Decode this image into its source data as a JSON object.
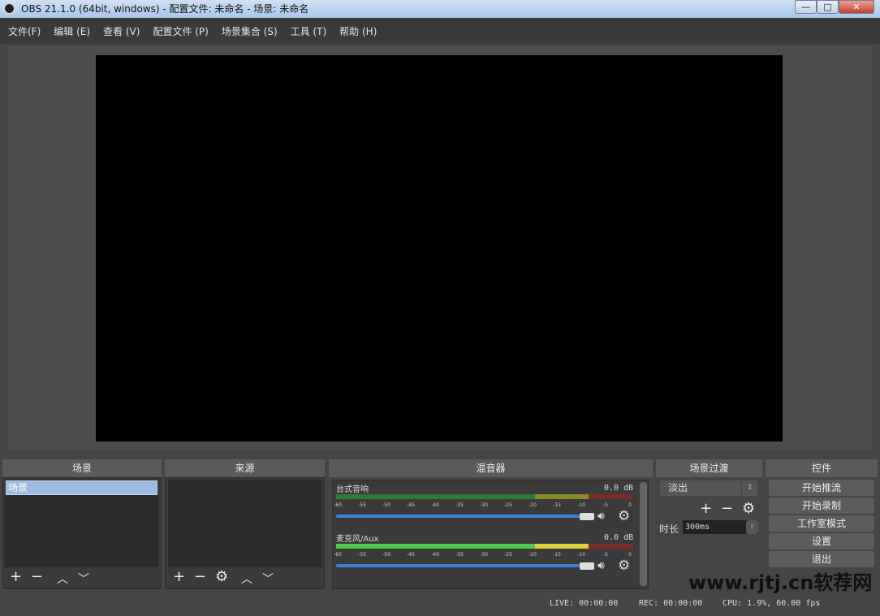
{
  "window": {
    "title": "OBS 21.1.0 (64bit, windows) - 配置文件: 未命名 - 场景: 未命名",
    "minimize": "—",
    "maximize": "□",
    "close": "✕"
  },
  "menu": [
    "文件(F)",
    "编辑 (E)",
    "查看 (V)",
    "配置文件 (P)",
    "场景集合 (S)",
    "工具 (T)",
    "帮助 (H)"
  ],
  "docks": {
    "scenes": "场景",
    "sources": "来源",
    "mixer": "混音器",
    "transitions": "场景过渡",
    "controls": "控件"
  },
  "scenes": {
    "items": [
      "场景"
    ],
    "selected": 0
  },
  "mixer": {
    "ticks": [
      "-60",
      "-55",
      "-50",
      "-45",
      "-40",
      "-35",
      "-30",
      "-25",
      "-20",
      "-15",
      "-10",
      "-5",
      "0"
    ],
    "channels": [
      {
        "name": "台式音响",
        "db": "0.0 dB",
        "volume": 1.0
      },
      {
        "name": "麦克风/Aux",
        "db": "0.0 dB",
        "volume": 1.0
      }
    ]
  },
  "transitions": {
    "selected": "淡出",
    "duration_label": "时长",
    "duration": "300ms"
  },
  "controls": [
    "开始推流",
    "开始录制",
    "工作室模式",
    "设置",
    "退出"
  ],
  "status": {
    "live": "LIVE: 00:00:00",
    "rec": "REC: 00:00:00",
    "cpu": "CPU: 1.9%, 60.00 fps"
  },
  "watermark": "www.rjtj.cn软荐网",
  "colors": {
    "accent": "#3d7fd6",
    "meter_green": "#2e7d32",
    "meter_yellow": "#8a8a2a",
    "meter_red": "#7a2a2a"
  }
}
